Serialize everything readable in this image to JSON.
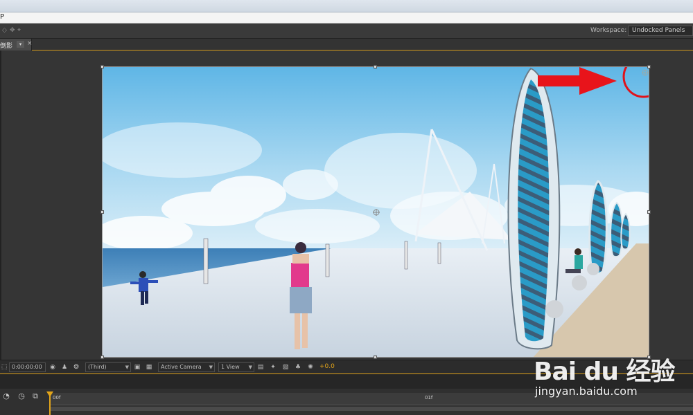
{
  "menu": {
    "fragment": "P"
  },
  "toolbar": {
    "workspace_label": "Workspace:",
    "workspace_value": "Undocked Panels"
  },
  "composition_tab": {
    "label": "倒影"
  },
  "viewer_bar": {
    "timecode": "0:00:00:00",
    "channel_select": "(Third)",
    "camera_select": "Active Camera",
    "views_select": "1 View",
    "exposure": "+0.0"
  },
  "timeline": {
    "start_label": "00f",
    "marker_label": "01f"
  },
  "watermark": {
    "brand": "Bai du 经验",
    "url": "jingyan.baidu.com"
  },
  "annotations": {
    "arrow_color": "#e8141b",
    "circle_color": "#e0121a"
  },
  "colors": {
    "accent_orange": "#e3a51a",
    "panel_bg": "#353535"
  }
}
